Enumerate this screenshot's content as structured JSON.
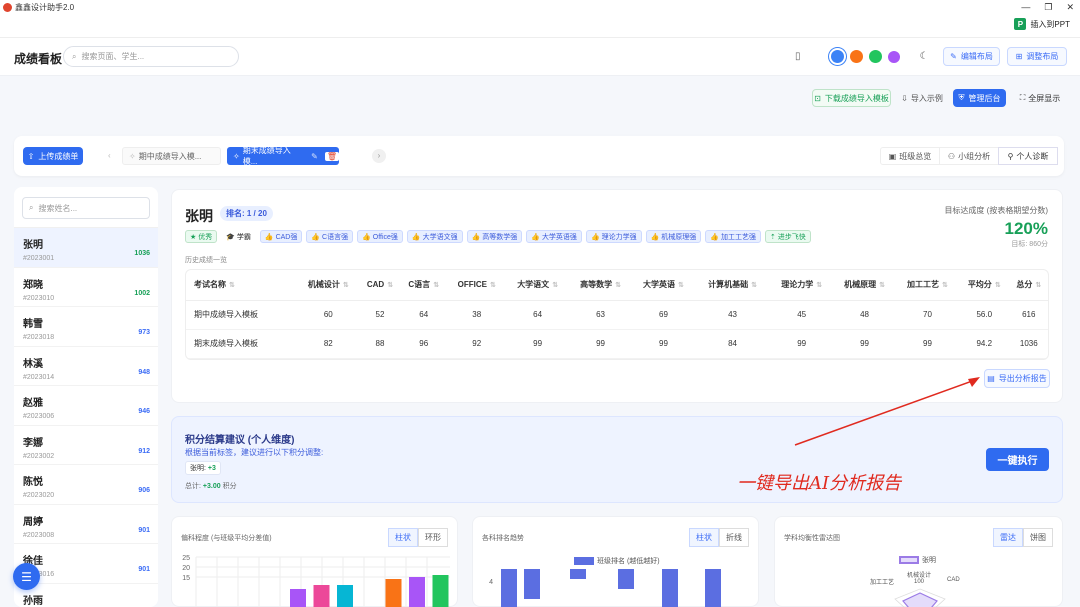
{
  "app": {
    "title": "鑫鑫设计助手2.0",
    "ppt_button": "插入到PPT"
  },
  "header": {
    "brand": "成绩看板",
    "search_placeholder": "搜索页面、学生...",
    "edit_layout": "编辑布局",
    "adjust_layout": "调整布局",
    "theme_colors": [
      "#3b82f6",
      "#f97316",
      "#22c55e",
      "#a855f7"
    ]
  },
  "toolbar": {
    "download_template": "下载成绩导入模板",
    "import_example": "导入示例",
    "admin": "管理后台",
    "fullscreen": "全屏显示"
  },
  "tabs": {
    "upload": "上传成绩单",
    "tab1": "期中成绩导入模...",
    "tab2": "期末成绩导入模...",
    "overview": "班级总览",
    "group": "小组分析",
    "personal": "个人诊断"
  },
  "sidebar": {
    "search_placeholder": "搜索姓名...",
    "students": [
      {
        "name": "张明",
        "id": "#2023001",
        "score": "1036"
      },
      {
        "name": "郑晓",
        "id": "#2023010",
        "score": "1002"
      },
      {
        "name": "韩雪",
        "id": "#2023018",
        "score": "973"
      },
      {
        "name": "林溪",
        "id": "#2023014",
        "score": "948"
      },
      {
        "name": "赵雅",
        "id": "#2023006",
        "score": "946"
      },
      {
        "name": "李娜",
        "id": "#2023002",
        "score": "912"
      },
      {
        "name": "陈悦",
        "id": "#2023020",
        "score": "906"
      },
      {
        "name": "周婷",
        "id": "#2023008",
        "score": "901"
      },
      {
        "name": "徐佳",
        "id": "#2023016",
        "score": "901"
      },
      {
        "name": "孙雨",
        "id": "",
        "score": ""
      }
    ]
  },
  "student": {
    "name": "张明",
    "rank": "排名: 1 / 20",
    "badges": [
      "优秀",
      "学霸"
    ],
    "tags": [
      "CAD强",
      "C语言强",
      "Office强",
      "大学语文强",
      "高等数学强",
      "大学英语强",
      "理论力学强",
      "机械原理强",
      "加工工艺强"
    ],
    "progress_tag": "进步飞快",
    "history_label": "历史成绩一览",
    "target_label": "目标达成度 (按表格期望分数)",
    "target_value": "120%",
    "target_note": "目标: 860分",
    "export_btn": "导出分析报告"
  },
  "table": {
    "headers": [
      "考试名称",
      "机械设计",
      "CAD",
      "C语言",
      "OFFICE",
      "大学语文",
      "高等数学",
      "大学英语",
      "计算机基础",
      "理论力学",
      "机械原理",
      "加工工艺",
      "平均分",
      "总分"
    ],
    "rows": [
      [
        "期中成绩导入模板",
        "60",
        "52",
        "64",
        "38",
        "64",
        "63",
        "69",
        "43",
        "45",
        "48",
        "70",
        "56.0",
        "616"
      ],
      [
        "期末成绩导入模板",
        "82",
        "88",
        "96",
        "92",
        "99",
        "99",
        "99",
        "84",
        "99",
        "99",
        "99",
        "94.2",
        "1036"
      ]
    ]
  },
  "suggestion": {
    "title": "积分结算建议 (个人维度)",
    "subtitle": "根据当前标签，建议进行以下积分调整:",
    "chip": "张明",
    "chip_value": "+3",
    "total_label": "总计:",
    "total_value": "+3.00",
    "total_unit": "积分",
    "run_btn": "一键执行"
  },
  "annotation": "一键导出AI分析报告",
  "charts": {
    "c1_title": "偏科程度 (与班级平均分差值)",
    "c1_tabs": [
      "柱状",
      "环形"
    ],
    "c2_title": "各科排名趋势",
    "c2_tabs": [
      "柱状",
      "折线"
    ],
    "c2_legend": "班级排名 (越低越好)",
    "c3_title": "学科均衡性雷达图",
    "c3_tabs": [
      "雷达",
      "饼图"
    ],
    "c3_legend": "张明",
    "c3_labels": [
      "机械设计",
      "100",
      "加工工艺",
      "CAD"
    ]
  },
  "chart_data": [
    {
      "type": "bar",
      "title": "偏科程度 (与班级平均分差值)",
      "yticks": [
        25,
        20,
        15
      ],
      "ylim": [
        0,
        25
      ],
      "values": [
        9,
        11,
        11,
        14,
        15,
        16
      ],
      "colors": [
        "#a855f7",
        "#ec4899",
        "#06b6d4",
        "#f97316",
        "#a855f7",
        "#22c55e"
      ]
    },
    {
      "type": "bar",
      "title": "各科排名趋势",
      "yticks": [
        4
      ],
      "series": [
        {
          "name": "班级排名 (越低越好)",
          "values": [
            4,
            3,
            1,
            2,
            4,
            4
          ]
        }
      ]
    }
  ]
}
